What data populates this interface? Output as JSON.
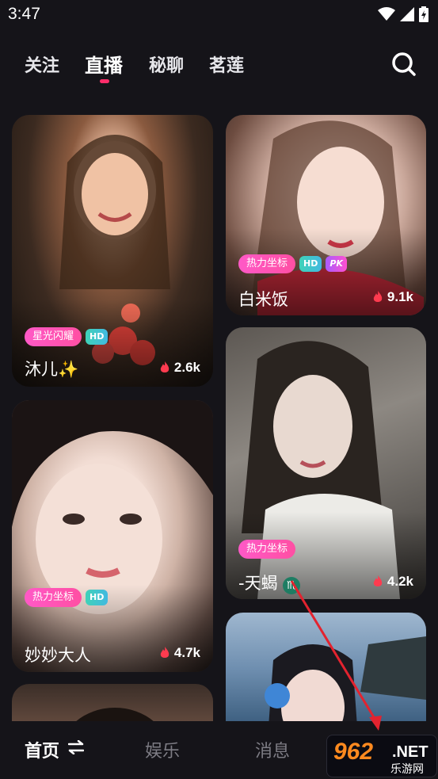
{
  "status_bar": {
    "time": "3:47"
  },
  "top_tabs": [
    {
      "label": "关注",
      "active": false
    },
    {
      "label": "直播",
      "active": true
    },
    {
      "label": "秘聊",
      "active": false
    },
    {
      "label": "茗莲",
      "active": false
    }
  ],
  "cards": [
    {
      "name": "沐儿",
      "name_suffix": "✨",
      "heat": "2.6k",
      "badges": [
        "星光闪耀"
      ],
      "hd": "HD",
      "pk": ""
    },
    {
      "name": "白米饭",
      "name_suffix": "",
      "heat": "9.1k",
      "badges": [
        "热力坐标"
      ],
      "hd": "HD",
      "pk": "PK"
    },
    {
      "name": "妙妙大人",
      "name_suffix": "",
      "heat": "4.7k",
      "badges": [
        "热力坐标"
      ],
      "hd": "HD",
      "pk": ""
    },
    {
      "name": "-天蝎",
      "name_suffix": "♏",
      "heat": "4.2k",
      "badges": [
        "热力坐标"
      ],
      "hd": "",
      "pk": ""
    }
  ],
  "bottom_nav": [
    {
      "label": "首页",
      "active": true
    },
    {
      "label": "娱乐",
      "active": false
    },
    {
      "label": "消息",
      "active": false
    }
  ],
  "watermark": {
    "number": "962",
    "suffix": ".NET",
    "subtitle": "乐游网"
  },
  "colors": {
    "accent": "#ff2d6a",
    "badge_pink": "#ff59c7",
    "hd_teal": "#3fd2b8",
    "background": "#151419"
  }
}
